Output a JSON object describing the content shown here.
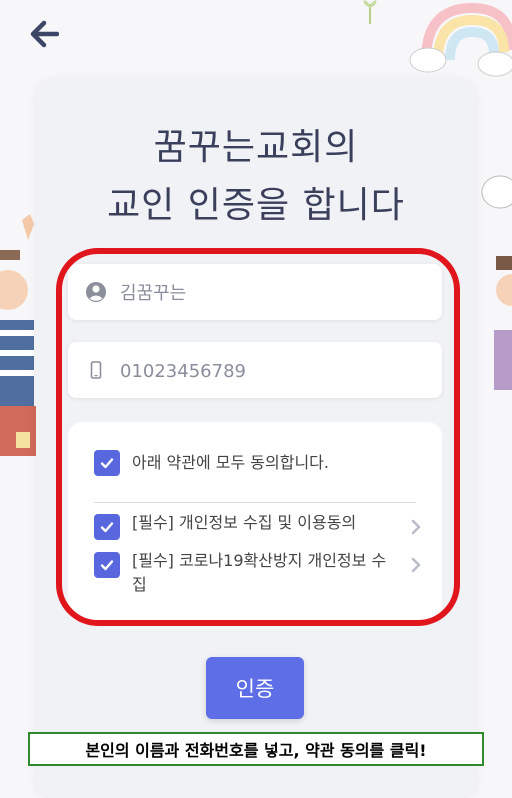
{
  "header": {
    "back_icon": "arrow-left-icon"
  },
  "card": {
    "title_line1": "꿈꾸는교회의",
    "title_line2": "교인 인증을 합니다"
  },
  "form": {
    "name_placeholder": "김꿈꾸는",
    "name_icon": "user-circle-icon",
    "phone_placeholder": "01023456789",
    "phone_icon": "mobile-phone-icon"
  },
  "terms": {
    "agree_all": "아래 약관에 모두 동의합니다.",
    "items": [
      {
        "label": "[필수] 개인정보 수집 및 이용동의",
        "checked": true
      },
      {
        "label": "[필수] 코로나19확산방지 개인정보 수집",
        "checked": true
      }
    ],
    "agree_all_checked": true
  },
  "submit_label": "인증",
  "caption": "본인의 이름과 전화번호를 넣고, 약관 동의를 클릭!",
  "colors": {
    "accent": "#5d6ee6",
    "title": "#3a3f5c",
    "highlight": "#e0161c",
    "caption_border": "#2f8a2f"
  }
}
